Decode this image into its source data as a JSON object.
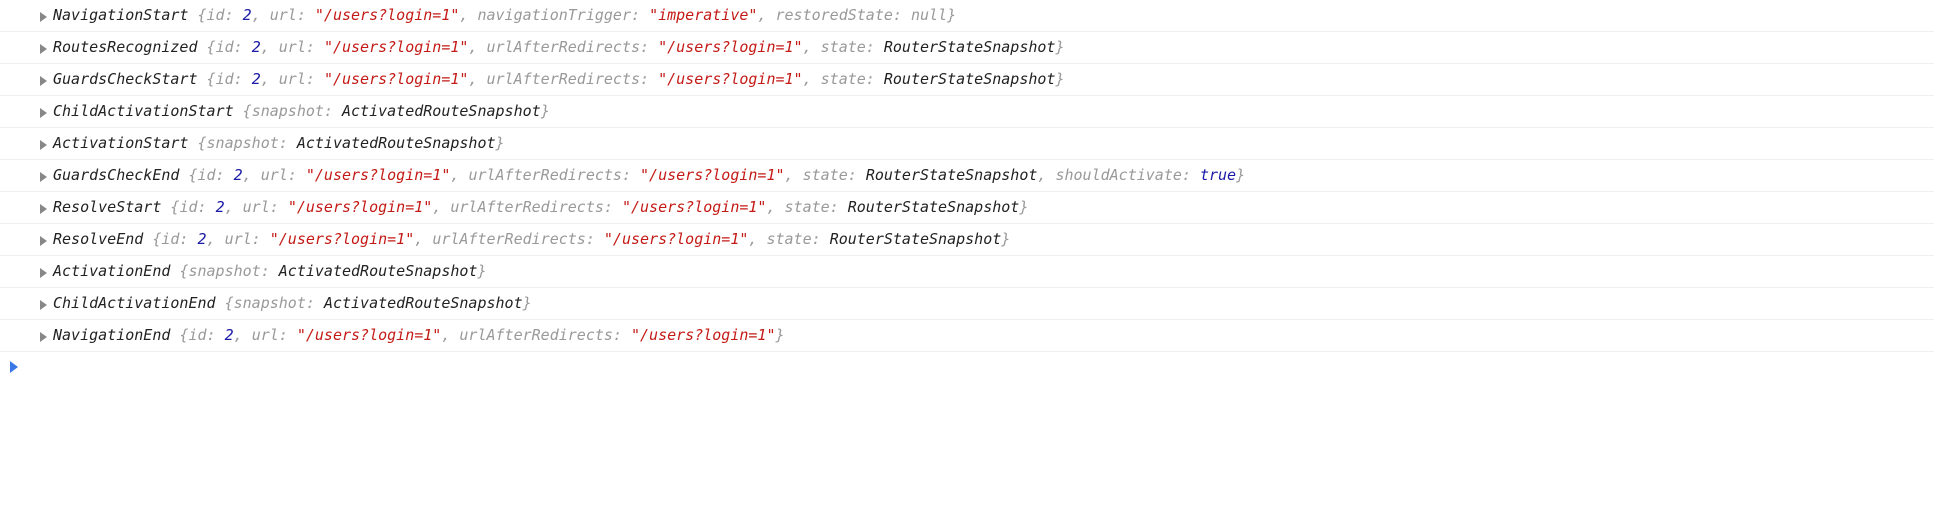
{
  "events": [
    {
      "name": "NavigationStart",
      "props": [
        {
          "k": "id",
          "t": "num",
          "v": "2"
        },
        {
          "k": "url",
          "t": "str",
          "v": "\"/users?login=1\""
        },
        {
          "k": "navigationTrigger",
          "t": "str",
          "v": "\"imperative\""
        },
        {
          "k": "restoredState",
          "t": "nul",
          "v": "null"
        }
      ]
    },
    {
      "name": "RoutesRecognized",
      "props": [
        {
          "k": "id",
          "t": "num",
          "v": "2"
        },
        {
          "k": "url",
          "t": "str",
          "v": "\"/users?login=1\""
        },
        {
          "k": "urlAfterRedirects",
          "t": "str",
          "v": "\"/users?login=1\""
        },
        {
          "k": "state",
          "t": "ident",
          "v": "RouterStateSnapshot"
        }
      ]
    },
    {
      "name": "GuardsCheckStart",
      "props": [
        {
          "k": "id",
          "t": "num",
          "v": "2"
        },
        {
          "k": "url",
          "t": "str",
          "v": "\"/users?login=1\""
        },
        {
          "k": "urlAfterRedirects",
          "t": "str",
          "v": "\"/users?login=1\""
        },
        {
          "k": "state",
          "t": "ident",
          "v": "RouterStateSnapshot"
        }
      ]
    },
    {
      "name": "ChildActivationStart",
      "props": [
        {
          "k": "snapshot",
          "t": "ident",
          "v": "ActivatedRouteSnapshot"
        }
      ]
    },
    {
      "name": "ActivationStart",
      "props": [
        {
          "k": "snapshot",
          "t": "ident",
          "v": "ActivatedRouteSnapshot"
        }
      ]
    },
    {
      "name": "GuardsCheckEnd",
      "props": [
        {
          "k": "id",
          "t": "num",
          "v": "2"
        },
        {
          "k": "url",
          "t": "str",
          "v": "\"/users?login=1\""
        },
        {
          "k": "urlAfterRedirects",
          "t": "str",
          "v": "\"/users?login=1\""
        },
        {
          "k": "state",
          "t": "ident",
          "v": "RouterStateSnapshot"
        },
        {
          "k": "shouldActivate",
          "t": "btrue",
          "v": "true"
        }
      ]
    },
    {
      "name": "ResolveStart",
      "props": [
        {
          "k": "id",
          "t": "num",
          "v": "2"
        },
        {
          "k": "url",
          "t": "str",
          "v": "\"/users?login=1\""
        },
        {
          "k": "urlAfterRedirects",
          "t": "str",
          "v": "\"/users?login=1\""
        },
        {
          "k": "state",
          "t": "ident",
          "v": "RouterStateSnapshot"
        }
      ]
    },
    {
      "name": "ResolveEnd",
      "props": [
        {
          "k": "id",
          "t": "num",
          "v": "2"
        },
        {
          "k": "url",
          "t": "str",
          "v": "\"/users?login=1\""
        },
        {
          "k": "urlAfterRedirects",
          "t": "str",
          "v": "\"/users?login=1\""
        },
        {
          "k": "state",
          "t": "ident",
          "v": "RouterStateSnapshot"
        }
      ]
    },
    {
      "name": "ActivationEnd",
      "props": [
        {
          "k": "snapshot",
          "t": "ident",
          "v": "ActivatedRouteSnapshot"
        }
      ]
    },
    {
      "name": "ChildActivationEnd",
      "props": [
        {
          "k": "snapshot",
          "t": "ident",
          "v": "ActivatedRouteSnapshot"
        }
      ]
    },
    {
      "name": "NavigationEnd",
      "props": [
        {
          "k": "id",
          "t": "num",
          "v": "2"
        },
        {
          "k": "url",
          "t": "str",
          "v": "\"/users?login=1\""
        },
        {
          "k": "urlAfterRedirects",
          "t": "str",
          "v": "\"/users?login=1\""
        }
      ]
    }
  ]
}
